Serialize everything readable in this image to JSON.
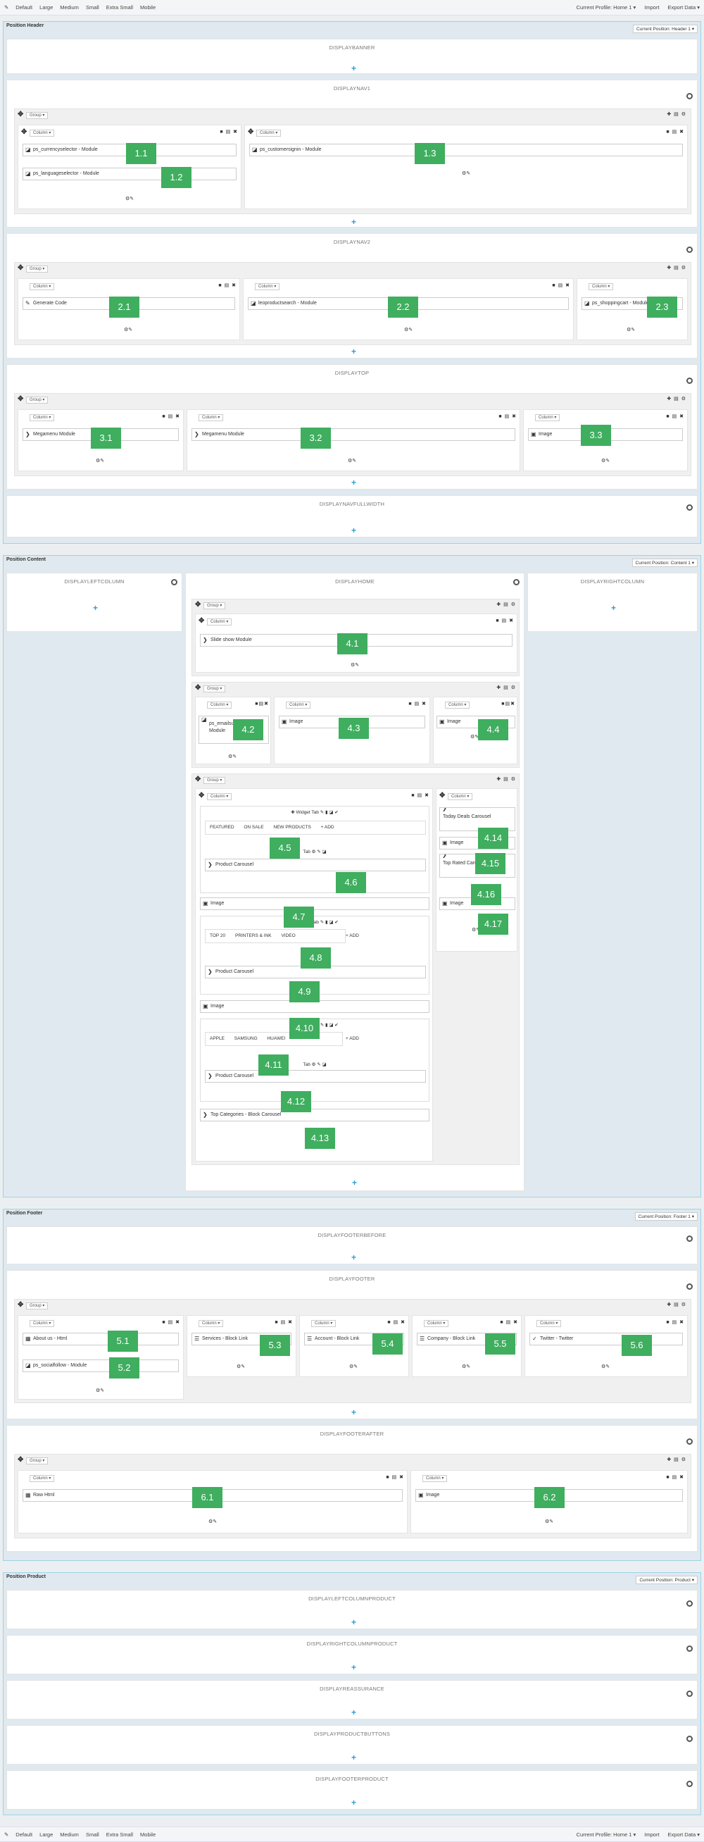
{
  "toolbar": {
    "items": [
      "Default",
      "Large",
      "Medium",
      "Small",
      "Extra Small",
      "Mobile"
    ],
    "profile": "Current Profile: Home 1 ▾",
    "import": "Import",
    "export": "Export Data ▾"
  },
  "common": {
    "group": "Group ▾",
    "column": "Column ▾",
    "plus": "+"
  },
  "sections": {
    "header": {
      "title": "Position Header",
      "dropdown": "Current Position: Header 1 ▾"
    },
    "content": {
      "title": "Position Content",
      "dropdown": "Current Position: Content 1 ▾"
    },
    "footer": {
      "title": "Position Footer",
      "dropdown": "Current Position: Footer 1 ▾"
    },
    "product": {
      "title": "Position Product",
      "dropdown": "Current Position: Product ▾"
    }
  },
  "hooks": {
    "displaybanner": "DISPLAYBANNER",
    "displaynav1": "DISPLAYNAV1",
    "displaynav2": "DISPLAYNAV2",
    "displaytop": "DISPLAYTOP",
    "displaynavfullwidth": "DISPLAYNAVFULLWIDTH",
    "displayleftcolumn": "DISPLAYLEFTCOLUMN",
    "displayhome": "DISPLAYHOME",
    "displayrightcolumn": "DISPLAYRIGHTCOLUMN",
    "displayfooterbefore": "DISPLAYFOOTERBEFORE",
    "displayfooter": "DISPLAYFOOTER",
    "displayfooterafter": "DISPLAYFOOTERAFTER",
    "displayleftcolumnproduct": "DISPLAYLEFTCOLUMNPRODUCT",
    "displayrightcolumnproduct": "DISPLAYRIGHTCOLUMNPRODUCT",
    "displayreassurance": "DISPLAYREASSURANCE",
    "displayproductbuttons": "DISPLAYPRODUCTBUTTONS",
    "displayfooterproduct": "DISPLAYFOOTERPRODUCT"
  },
  "modules": {
    "m11": "ps_currencyselector - Module",
    "m12": "ps_languageselector - Module",
    "m13": "ps_customersignin - Module",
    "m21": "Generate Code",
    "m22": "leoproductsearch - Module",
    "m23": "ps_shoppingcart - Module",
    "m31": "Megamenu Module",
    "m32": "Megamenu Module",
    "m33": "Image",
    "m41": "Slide show Module",
    "m42": "ps_emailsubscription - Module",
    "m43": "Image",
    "m44": "Image",
    "m46": "Product Carousel",
    "m47": "Image",
    "m49": "Product Carousel",
    "m410": "Image",
    "m412": "Product Carousel",
    "m413": "Top Categories - Block Carousel",
    "m414": "Today Deals Carousel",
    "m415": "Image",
    "m416": "Top Rated Carousel",
    "m417": "Image",
    "m51": "About us - Html",
    "m52": "ps_socialfollow - Module",
    "m53": "Services - Block Link",
    "m54": "Account - Block Link",
    "m55": "Company - Block Link",
    "m56": "Twitter - Twitter",
    "m61": "Raw Html",
    "m62": "Image"
  },
  "widget_tab": "Widget Tab",
  "tab_label": "Tab",
  "add": "+ ADD",
  "tabs1": [
    "FEATURED",
    "ON SALE",
    "NEW PRODUCTS"
  ],
  "tabs2": [
    "TOP 20",
    "PRINTERS & INK",
    "VIDEO"
  ],
  "tabs3": [
    "APPLE",
    "SAMSUNG",
    "HUAWEI"
  ],
  "badges": {
    "b11": "1.1",
    "b12": "1.2",
    "b13": "1.3",
    "b21": "2.1",
    "b22": "2.2",
    "b23": "2.3",
    "b31": "3.1",
    "b32": "3.2",
    "b33": "3.3",
    "b41": "4.1",
    "b42": "4.2",
    "b43": "4.3",
    "b44": "4.4",
    "b45": "4.5",
    "b46": "4.6",
    "b47": "4.7",
    "b48": "4.8",
    "b49": "4.9",
    "b410": "4.10",
    "b411": "4.11",
    "b412": "4.12",
    "b413": "4.13",
    "b414": "4.14",
    "b415": "4.15",
    "b416": "4.16",
    "b417": "4.17",
    "b51": "5.1",
    "b52": "5.2",
    "b53": "5.3",
    "b54": "5.4",
    "b55": "5.5",
    "b56": "5.6",
    "b61": "6.1",
    "b62": "6.2"
  }
}
